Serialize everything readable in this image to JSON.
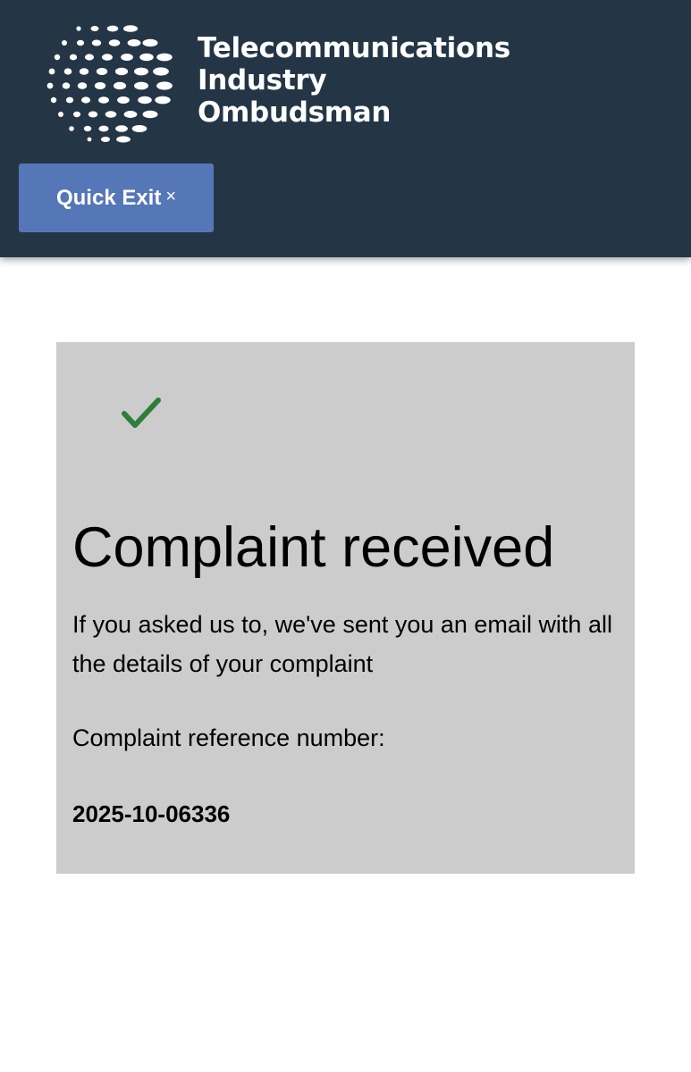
{
  "header": {
    "logo_lines": [
      "Telecommunications",
      "Industry",
      "Ombudsman"
    ],
    "logo_icon": "dotted-globe-logo",
    "quick_exit": {
      "label": "Quick Exit",
      "icon": "close-icon",
      "icon_glyph": "×"
    }
  },
  "confirmation": {
    "status_icon": "check-icon",
    "title": "Complaint received",
    "message": "If you asked us to, we've sent you an email with all the details of your complaint",
    "reference_label": "Complaint reference number:",
    "reference_number": "2025-10-06336"
  },
  "colors": {
    "header_bg": "#243646",
    "button_bg": "#5577b8",
    "panel_bg": "#cccccc",
    "success": "#2e7d3a"
  }
}
